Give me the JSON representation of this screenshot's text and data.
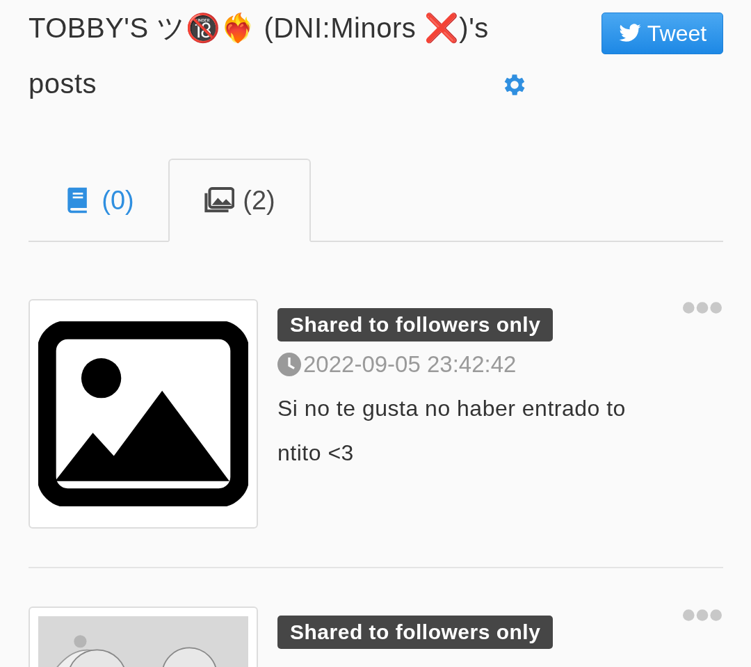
{
  "header": {
    "title": "TOBBY'S ツ🔞❤️‍🔥 (DNI:Minors ❌)'s posts",
    "tweet_button": "Tweet"
  },
  "tabs": [
    {
      "kind": "book",
      "label": "(0)",
      "selected": false
    },
    {
      "kind": "images",
      "label": "(2)",
      "selected": true
    }
  ],
  "posts": [
    {
      "kind": "placeholder",
      "badge": "Shared to followers only",
      "date": "2022-09-05 23:42:42",
      "text": "Si no te gusta no haber entrado to ntito <3"
    },
    {
      "kind": "picture",
      "badge": "Shared to followers only"
    }
  ]
}
